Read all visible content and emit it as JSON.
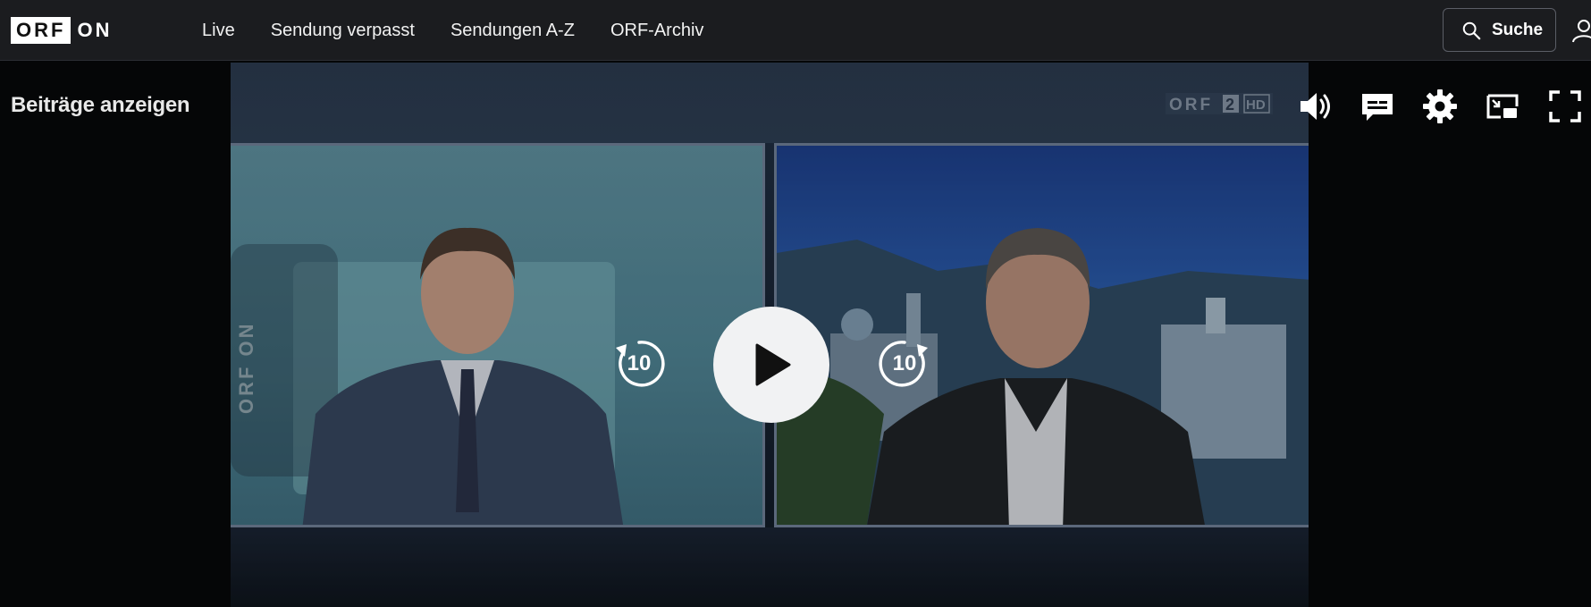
{
  "header": {
    "logo_box": "ORF",
    "logo_suffix": "ON",
    "nav": [
      {
        "label": "Live"
      },
      {
        "label": "Sendung verpasst"
      },
      {
        "label": "Sendungen A-Z"
      },
      {
        "label": "ORF-Archiv"
      }
    ],
    "search_label": "Suche"
  },
  "sidebar": {
    "show_items_label": "Beiträge anzeigen"
  },
  "player": {
    "channel_badge": "ORF 2 HD",
    "watermark_text": "ORF ON",
    "rewind_seconds": "10",
    "forward_seconds": "10",
    "controls": [
      "volume-icon",
      "subtitles-icon",
      "settings-icon",
      "picture-in-picture-icon",
      "fullscreen-icon"
    ]
  },
  "colors": {
    "header_bg": "#1b1c1f",
    "page_bg": "#050607",
    "accent_white": "#ffffff"
  }
}
